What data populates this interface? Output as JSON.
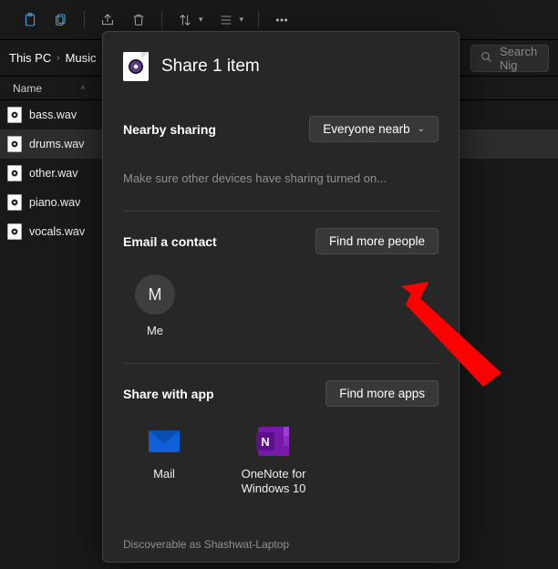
{
  "toolbar": {
    "icons": [
      "pin-icon",
      "copy-icon",
      "share-icon",
      "delete-icon",
      "sort-icon",
      "view-icon",
      "more-icon"
    ]
  },
  "breadcrumb": {
    "root": "This PC",
    "folder": "Music"
  },
  "search": {
    "placeholder": "Search Nig"
  },
  "columns": {
    "name": "Name"
  },
  "files": [
    {
      "name": "bass.wav"
    },
    {
      "name": "drums.wav"
    },
    {
      "name": "other.wav"
    },
    {
      "name": "piano.wav"
    },
    {
      "name": "vocals.wav"
    }
  ],
  "selected_index": 1,
  "share": {
    "title": "Share 1 item",
    "nearby": {
      "label": "Nearby sharing",
      "dropdown_value": "Everyone nearb",
      "hint": "Make sure other devices have sharing turned on..."
    },
    "email": {
      "label": "Email a contact",
      "button": "Find more people",
      "contacts": [
        {
          "initial": "M",
          "label": "Me"
        }
      ]
    },
    "apps": {
      "label": "Share with app",
      "button": "Find more apps",
      "items": [
        {
          "icon": "mail-app-icon",
          "label": "Mail"
        },
        {
          "icon": "onenote-app-icon",
          "label": "OneNote for Windows 10"
        }
      ]
    },
    "footer": "Discoverable as Shashwat-Laptop"
  }
}
